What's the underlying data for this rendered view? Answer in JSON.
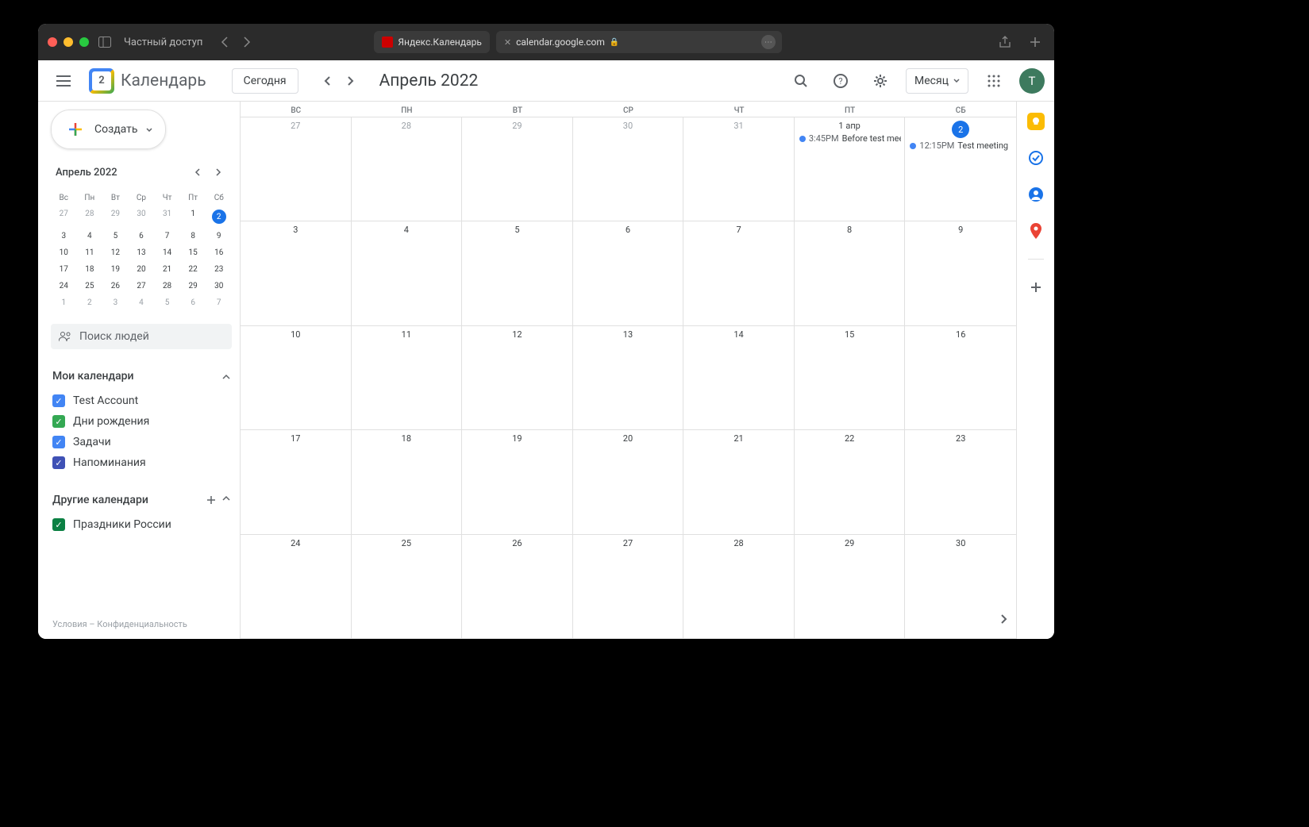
{
  "browser": {
    "private_label": "Частный доступ",
    "tab1_label": "Яндекс.Календарь",
    "address": "calendar.google.com"
  },
  "header": {
    "app_name": "Календарь",
    "logo_day": "2",
    "today_label": "Сегодня",
    "title": "Апрель 2022",
    "view_label": "Месяц",
    "avatar_initial": "T"
  },
  "sidebar": {
    "create_label": "Создать",
    "mini_title": "Апрель 2022",
    "dow": [
      "Вс",
      "Пн",
      "Вт",
      "Ср",
      "Чт",
      "Пт",
      "Сб"
    ],
    "mini_days": [
      {
        "n": "27",
        "dim": true
      },
      {
        "n": "28",
        "dim": true
      },
      {
        "n": "29",
        "dim": true
      },
      {
        "n": "30",
        "dim": true
      },
      {
        "n": "31",
        "dim": true
      },
      {
        "n": "1"
      },
      {
        "n": "2",
        "today": true
      },
      {
        "n": "3"
      },
      {
        "n": "4"
      },
      {
        "n": "5"
      },
      {
        "n": "6"
      },
      {
        "n": "7"
      },
      {
        "n": "8"
      },
      {
        "n": "9"
      },
      {
        "n": "10"
      },
      {
        "n": "11"
      },
      {
        "n": "12"
      },
      {
        "n": "13"
      },
      {
        "n": "14"
      },
      {
        "n": "15"
      },
      {
        "n": "16"
      },
      {
        "n": "17"
      },
      {
        "n": "18"
      },
      {
        "n": "19"
      },
      {
        "n": "20"
      },
      {
        "n": "21"
      },
      {
        "n": "22"
      },
      {
        "n": "23"
      },
      {
        "n": "24"
      },
      {
        "n": "25"
      },
      {
        "n": "26"
      },
      {
        "n": "27"
      },
      {
        "n": "28"
      },
      {
        "n": "29"
      },
      {
        "n": "30"
      },
      {
        "n": "1",
        "dim": true
      },
      {
        "n": "2",
        "dim": true
      },
      {
        "n": "3",
        "dim": true
      },
      {
        "n": "4",
        "dim": true
      },
      {
        "n": "5",
        "dim": true
      },
      {
        "n": "6",
        "dim": true
      },
      {
        "n": "7",
        "dim": true
      }
    ],
    "search_placeholder": "Поиск людей",
    "my_calendars_title": "Мои календари",
    "my_calendars": [
      {
        "label": "Test Account",
        "color": "#4285f4"
      },
      {
        "label": "Дни рождения",
        "color": "#34a853"
      },
      {
        "label": "Задачи",
        "color": "#4285f4"
      },
      {
        "label": "Напоминания",
        "color": "#3f51b5"
      }
    ],
    "other_calendars_title": "Другие календари",
    "other_calendars": [
      {
        "label": "Праздники России",
        "color": "#0b8043"
      }
    ],
    "footer": "Условия – Конфиденциальность"
  },
  "grid": {
    "dow": [
      "ВС",
      "ПН",
      "ВТ",
      "СР",
      "ЧТ",
      "ПТ",
      "СБ"
    ],
    "weeks": [
      [
        {
          "n": "27",
          "dim": true
        },
        {
          "n": "28",
          "dim": true
        },
        {
          "n": "29",
          "dim": true
        },
        {
          "n": "30",
          "dim": true
        },
        {
          "n": "31",
          "dim": true
        },
        {
          "n": "1 апр",
          "events": [
            {
              "time": "3:45PM",
              "title": "Before test meetin",
              "color": "#4285f4"
            }
          ]
        },
        {
          "n": "2",
          "today": true,
          "events": [
            {
              "time": "12:15PM",
              "title": "Test meeting",
              "color": "#4285f4"
            }
          ]
        }
      ],
      [
        {
          "n": "3"
        },
        {
          "n": "4"
        },
        {
          "n": "5"
        },
        {
          "n": "6"
        },
        {
          "n": "7"
        },
        {
          "n": "8"
        },
        {
          "n": "9"
        }
      ],
      [
        {
          "n": "10"
        },
        {
          "n": "11"
        },
        {
          "n": "12"
        },
        {
          "n": "13"
        },
        {
          "n": "14"
        },
        {
          "n": "15"
        },
        {
          "n": "16"
        }
      ],
      [
        {
          "n": "17"
        },
        {
          "n": "18"
        },
        {
          "n": "19"
        },
        {
          "n": "20"
        },
        {
          "n": "21"
        },
        {
          "n": "22"
        },
        {
          "n": "23"
        }
      ],
      [
        {
          "n": "24"
        },
        {
          "n": "25"
        },
        {
          "n": "26"
        },
        {
          "n": "27"
        },
        {
          "n": "28"
        },
        {
          "n": "29"
        },
        {
          "n": "30"
        }
      ]
    ]
  }
}
